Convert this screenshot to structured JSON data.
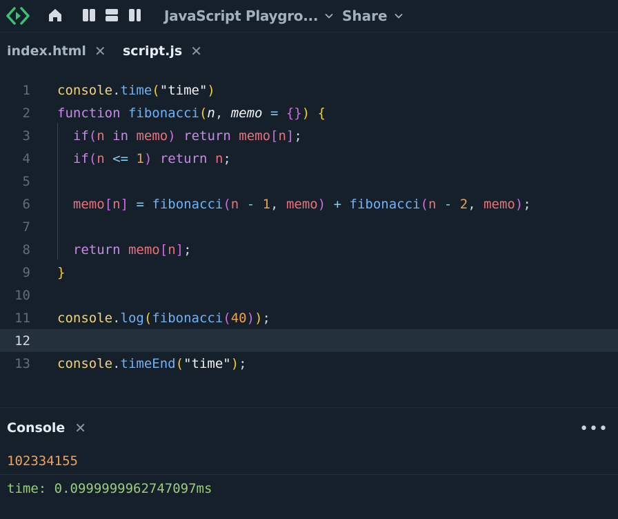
{
  "toolbar": {
    "title": "JavaScript Playgro...",
    "share_label": "Share",
    "icons": [
      "playground-logo-icon",
      "home-icon",
      "layout-columns-icon",
      "layout-rows-icon",
      "layout-sidebar-icon"
    ]
  },
  "tabs": [
    {
      "label": "index.html",
      "active": false
    },
    {
      "label": "script.js",
      "active": true
    }
  ],
  "editor": {
    "active_line": 12,
    "lines": [
      {
        "n": "1"
      },
      {
        "n": "2"
      },
      {
        "n": "3"
      },
      {
        "n": "4"
      },
      {
        "n": "5"
      },
      {
        "n": "6"
      },
      {
        "n": "7"
      },
      {
        "n": "8"
      },
      {
        "n": "9"
      },
      {
        "n": "10"
      },
      {
        "n": "11"
      },
      {
        "n": "12"
      },
      {
        "n": "13"
      }
    ],
    "code": [
      "console.time(\"time\")",
      "function fibonacci(n, memo = {}) {",
      "  if(n in memo) return memo[n];",
      "  if(n <= 1) return n;",
      "",
      "  memo[n] = fibonacci(n - 1, memo) + fibonacci(n - 2, memo);",
      "",
      "  return memo[n];",
      "}",
      "",
      "console.log(fibonacci(40));",
      "",
      "console.timeEnd(\"time\");"
    ]
  },
  "console": {
    "title": "Console",
    "outputs": [
      "102334155",
      "time: 0.0999999962747097ms"
    ]
  },
  "colors": {
    "background": "#15202b",
    "active_line": "#24303c"
  }
}
